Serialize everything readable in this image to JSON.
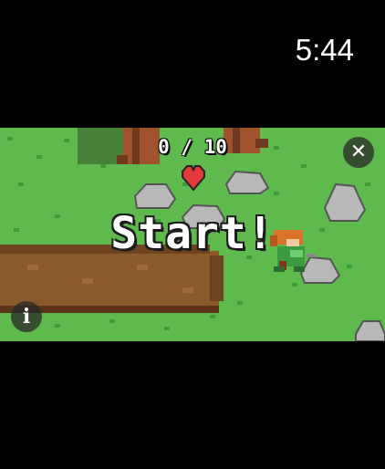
{
  "status_bar": {
    "time": "5:44"
  },
  "game": {
    "score_text": "0 / 10",
    "banner_text": "Start!",
    "close_button_icon": "close-icon",
    "info_button_icon": "info-icon",
    "close_glyph": "✕",
    "info_glyph": "i",
    "colors": {
      "grass": "#5fba4e",
      "dirt": "#8a5a2b",
      "rock": "#b8b8b8",
      "heart": "#e23a3a",
      "tree": "#a0522d"
    }
  }
}
